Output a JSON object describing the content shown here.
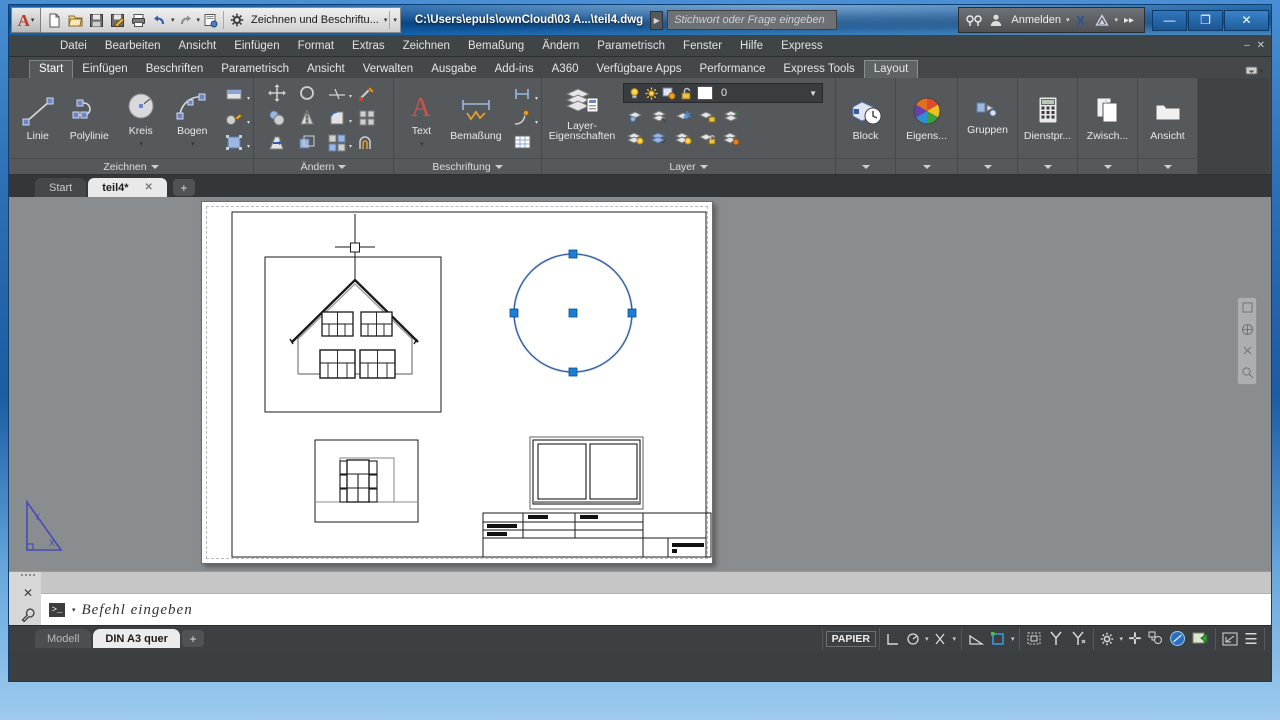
{
  "titlebar": {
    "app_icon": "autocad-logo-icon",
    "quick_access": [
      {
        "name": "new-file-icon",
        "glyph": "🗋"
      },
      {
        "name": "open-file-icon",
        "glyph": "🗁"
      },
      {
        "name": "save-icon",
        "glyph": "🖫"
      },
      {
        "name": "save-as-icon",
        "glyph": "🖬"
      },
      {
        "name": "plot-icon",
        "glyph": "🖶"
      },
      {
        "name": "undo-icon",
        "glyph": "↩"
      },
      {
        "name": "redo-icon",
        "glyph": "↪"
      },
      {
        "name": "plot-preview-icon",
        "glyph": "🖹"
      }
    ],
    "workspace_label": "Zeichnen und Beschriftu...",
    "document_title": "C:\\Users\\epuls\\ownCloud\\03 A...\\teil4.dwg",
    "search_placeholder": "Stichwort oder Frage eingeben",
    "signin_label": "Anmelden",
    "window_buttons": {
      "minimize": "—",
      "maximize": "❐",
      "close": "✕"
    },
    "accent_color": "#0b4e92"
  },
  "menubar": {
    "items": [
      "Datei",
      "Bearbeiten",
      "Ansicht",
      "Einfügen",
      "Format",
      "Extras",
      "Zeichnen",
      "Bemaßung",
      "Ändern",
      "Parametrisch",
      "Fenster",
      "Hilfe",
      "Express"
    ]
  },
  "ribbon_tabs": {
    "items": [
      "Start",
      "Einfügen",
      "Beschriften",
      "Parametrisch",
      "Ansicht",
      "Verwalten",
      "Ausgabe",
      "Add-ins",
      "A360",
      "Verfügbare Apps",
      "Performance",
      "Express Tools",
      "Layout"
    ],
    "active": "Start",
    "selected": "Layout"
  },
  "ribbon": {
    "panels": [
      {
        "name": "zeichnen",
        "label": "Zeichnen",
        "big_buttons": [
          {
            "name": "line-tool",
            "label": "Linie"
          },
          {
            "name": "polyline-tool",
            "label": "Polylinie"
          },
          {
            "name": "circle-tool",
            "label": "Kreis"
          },
          {
            "name": "arc-tool",
            "label": "Bogen"
          }
        ],
        "small_buttons": [
          {
            "name": "rectangle-tool"
          },
          {
            "name": "hatch-tool"
          },
          {
            "name": "region-tool"
          }
        ]
      },
      {
        "name": "aendern",
        "label": "Ändern",
        "small_buttons": [
          {
            "name": "move-tool"
          },
          {
            "name": "rotate-tool"
          },
          {
            "name": "trim-tool"
          },
          {
            "name": "fillet-tool"
          },
          {
            "name": "copy-tool"
          },
          {
            "name": "mirror-tool"
          },
          {
            "name": "chamfer-tool"
          },
          {
            "name": "array-tool"
          },
          {
            "name": "stretch-tool"
          },
          {
            "name": "scale-tool"
          },
          {
            "name": "explode-tool"
          },
          {
            "name": "offset-tool"
          }
        ]
      },
      {
        "name": "beschriftung",
        "label": "Beschriftung",
        "big_buttons": [
          {
            "name": "text-tool",
            "label": "Text"
          },
          {
            "name": "dimension-tool",
            "label": "Bemaßung"
          }
        ],
        "small_buttons": [
          {
            "name": "dimstyle-tool"
          },
          {
            "name": "leader-tool"
          },
          {
            "name": "table-tool"
          }
        ]
      },
      {
        "name": "layer",
        "label": "Layer",
        "big_buttons": [
          {
            "name": "layer-properties-tool",
            "label": "Layer-",
            "label2": "Eigenschaften"
          }
        ],
        "layer_combo": {
          "name": "layer-combo",
          "current_layer": "0",
          "color_swatch": "#ffffff",
          "icons": [
            "lightbulb-on-icon",
            "sun-icon",
            "freeze-icon",
            "unlock-icon"
          ]
        }
      },
      {
        "name": "block",
        "label": "Block",
        "big_buttons": [
          {
            "name": "insert-block-tool",
            "label": "Block"
          }
        ],
        "dropdown": true
      },
      {
        "name": "eigenschaften",
        "label": "Eigens...",
        "big_buttons": [
          {
            "name": "properties-tool",
            "label": "Eigens..."
          }
        ],
        "dropdown": true
      },
      {
        "name": "gruppen",
        "label": "Gruppen",
        "big_buttons": [
          {
            "name": "group-tool",
            "label": "Gruppen"
          }
        ],
        "dropdown": true
      },
      {
        "name": "dienstprogramme",
        "label": "Dienstpr...",
        "big_buttons": [
          {
            "name": "utilities-tool",
            "label": "Dienstpr..."
          }
        ],
        "dropdown": true
      },
      {
        "name": "zwischenablage",
        "label": "Zwisch...",
        "big_buttons": [
          {
            "name": "clipboard-tool",
            "label": "Zwisch..."
          }
        ],
        "dropdown": true
      },
      {
        "name": "ansicht",
        "label": "Ansicht",
        "big_buttons": [
          {
            "name": "view-tool",
            "label": "Ansicht"
          }
        ],
        "dropdown": true
      }
    ]
  },
  "doc_tabs": {
    "items": [
      {
        "name": "tab-start",
        "label": "Start",
        "active": false,
        "closable": false
      },
      {
        "name": "tab-teil4",
        "label": "teil4*",
        "active": true,
        "closable": true
      }
    ],
    "add_label": "+",
    "close_glyph": "✕"
  },
  "canvas": {
    "paper_label": "DIN A3 quer sheet",
    "ucs_icon": {
      "x_label": "X",
      "y_label": "Y"
    },
    "selected_object": "circle",
    "grip_color": "#1a7fd4",
    "nav_bar_icons": [
      "viewcube-icon",
      "steering-wheel-icon",
      "pan-icon",
      "zoom-icon"
    ]
  },
  "command_line": {
    "prompt_icon": "command-prompt-icon",
    "placeholder": "Befehl eingeben",
    "close_glyph": "✕",
    "settings_glyph": "🔧"
  },
  "status_bar": {
    "layout_tabs": [
      {
        "name": "tab-modell",
        "label": "Modell",
        "active": false
      },
      {
        "name": "tab-din-a3-quer",
        "label": "DIN A3 quer",
        "active": true
      }
    ],
    "add_layout_label": "+",
    "space_toggle": "PAPIER",
    "right_items": [
      {
        "name": "ortho-mode-icon",
        "glyph": "⌐"
      },
      {
        "name": "polar-tracking-icon",
        "glyph": "◔"
      },
      {
        "name": "osnap-icon",
        "glyph": "⌅"
      },
      {
        "name": "otrack-icon",
        "glyph": "∠"
      },
      {
        "name": "dynamic-ucs-icon",
        "glyph": "◻"
      },
      {
        "name": "annotation-scale-icon",
        "glyph": "▣"
      },
      {
        "name": "annotation-visibility-icon",
        "glyph": "⅄"
      },
      {
        "name": "annotation-autoscale-icon",
        "glyph": "⅄"
      },
      {
        "name": "workspace-switch-icon",
        "glyph": "⚙"
      },
      {
        "name": "hardware-accel-icon",
        "glyph": "✚"
      },
      {
        "name": "isolate-objects-icon",
        "glyph": "⚯"
      },
      {
        "name": "clean-screen-icon",
        "glyph": "◯"
      },
      {
        "name": "customization-icon",
        "glyph": "▦"
      },
      {
        "name": "fullscreen-icon",
        "glyph": "⤢"
      },
      {
        "name": "menu-icon",
        "glyph": "☰"
      }
    ]
  }
}
